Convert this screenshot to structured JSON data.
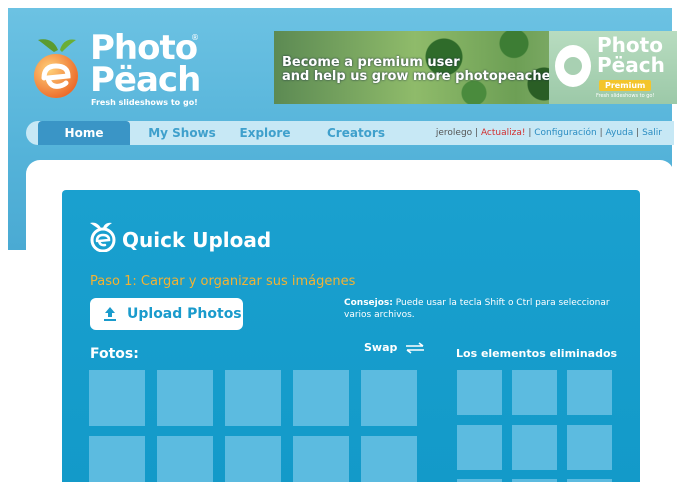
{
  "brand": {
    "name_line1": "Photo",
    "name_line2": "Pëach",
    "registered": "®",
    "tagline": "Fresh slideshows to go!"
  },
  "banner": {
    "line1": "Become a premium user",
    "line2": "and help us grow more photopeaches!",
    "logo_text_line1": "Photo",
    "logo_text_line2": "Pëach",
    "premium_badge": "Premium",
    "logo_tagline": "Fresh slideshows to go!"
  },
  "nav": {
    "items": [
      {
        "label": "Home"
      },
      {
        "label": "My Shows"
      },
      {
        "label": "Explore"
      },
      {
        "label": "Creators"
      }
    ],
    "user": {
      "username": "jerolego",
      "sep": " | ",
      "actualiza": "Actualiza!",
      "config": "Configuración",
      "ayuda": "Ayuda",
      "salir": "Salir"
    }
  },
  "upload": {
    "title": "Quick Upload",
    "step": "Paso 1: Cargar y organizar sus imágenes",
    "button_label": "Upload Photos",
    "tips_label": "Consejos:",
    "tips_text": "Puede usar la tecla Shift o Ctrl para seleccionar varios archivos.",
    "photos_label": "Fotos:",
    "swap_label": "Swap",
    "removed_label": "Los elementos eliminados"
  },
  "colors": {
    "header_bg": "#5ab6dc",
    "panel_bg": "#17a0cf",
    "tile": "#5cbbe0",
    "step_text": "#f2b233",
    "nav_active": "#3a95c6"
  }
}
